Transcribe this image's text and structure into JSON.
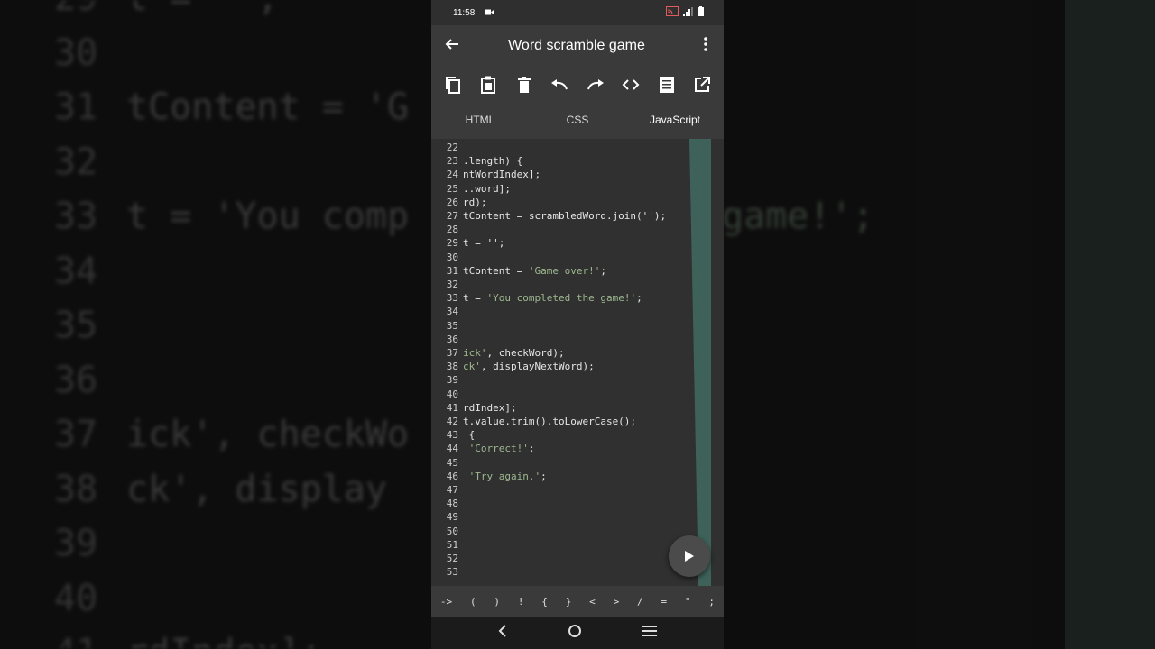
{
  "background": {
    "lines": [
      {
        "num": "29",
        "code": "t = '';"
      },
      {
        "num": "30",
        "code": ""
      },
      {
        "num": "31",
        "code": "tContent = 'G"
      },
      {
        "num": "32",
        "code": ""
      },
      {
        "num": "33",
        "code": "t = 'You comp",
        "tail": "game!';"
      },
      {
        "num": "34",
        "code": ""
      },
      {
        "num": "35",
        "code": ""
      },
      {
        "num": "36",
        "code": ""
      },
      {
        "num": "37",
        "code": "ick', checkWo"
      },
      {
        "num": "38",
        "code": "ck', display"
      },
      {
        "num": "39",
        "code": ""
      },
      {
        "num": "40",
        "code": ""
      },
      {
        "num": "41",
        "code": "rdIndex];"
      }
    ]
  },
  "status_bar": {
    "time": "11:58"
  },
  "app_bar": {
    "title": "Word scramble game",
    "back_icon": "arrow-left-icon",
    "menu_icon": "more-vert-icon"
  },
  "toolbar": {
    "icons": [
      "copy-icon",
      "paste-icon",
      "delete-icon",
      "undo-icon",
      "redo-icon",
      "code-icon",
      "document-icon",
      "open-external-icon"
    ]
  },
  "tabs": {
    "items": [
      "HTML",
      "CSS",
      "JavaScript"
    ],
    "active": "JavaScript"
  },
  "editor": {
    "lines": [
      {
        "n": "22",
        "c": ""
      },
      {
        "n": "23",
        "c": ".length) {"
      },
      {
        "n": "24",
        "c": "ntWordIndex];"
      },
      {
        "n": "25",
        "c": "..word];"
      },
      {
        "n": "26",
        "c": "rd);"
      },
      {
        "n": "27",
        "c": "tContent = scrambledWord.join('');"
      },
      {
        "n": "28",
        "c": ""
      },
      {
        "n": "29",
        "c": "t = '';"
      },
      {
        "n": "30",
        "c": ""
      },
      {
        "n": "31",
        "c": "tContent = ",
        "s": "'Game over!'",
        "e": ";"
      },
      {
        "n": "32",
        "c": ""
      },
      {
        "n": "33",
        "c": "t = ",
        "s": "'You completed the game!'",
        "e": ";"
      },
      {
        "n": "34",
        "c": ""
      },
      {
        "n": "35",
        "c": ""
      },
      {
        "n": "36",
        "c": ""
      },
      {
        "n": "37",
        "c": "",
        "s": "ick'",
        "e": ", checkWord);"
      },
      {
        "n": "38",
        "c": "",
        "s": "ck'",
        "e": ", displayNextWord);"
      },
      {
        "n": "39",
        "c": ""
      },
      {
        "n": "40",
        "c": ""
      },
      {
        "n": "41",
        "c": "rdIndex];"
      },
      {
        "n": "42",
        "c": "t.value.trim().toLowerCase();"
      },
      {
        "n": "43",
        "c": " {"
      },
      {
        "n": "44",
        "c": " ",
        "s": "'Correct!'",
        "e": ";"
      },
      {
        "n": "45",
        "c": ""
      },
      {
        "n": "46",
        "c": " ",
        "s": "'Try again.'",
        "e": ";"
      },
      {
        "n": "47",
        "c": ""
      },
      {
        "n": "48",
        "c": ""
      },
      {
        "n": "49",
        "c": ""
      },
      {
        "n": "50",
        "c": ""
      },
      {
        "n": "51",
        "c": ""
      },
      {
        "n": "52",
        "c": ""
      },
      {
        "n": "53",
        "c": ""
      }
    ]
  },
  "keys": [
    "->",
    "(",
    ")",
    "!",
    "{",
    "}",
    "<",
    ">",
    "/",
    "=",
    "\"",
    ";"
  ],
  "colors": {
    "accent_strip": "#3e6259",
    "string": "#9db78f"
  }
}
